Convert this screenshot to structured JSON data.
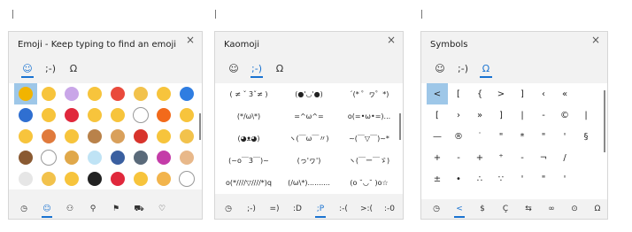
{
  "emoji_panel": {
    "title": "Emoji - Keep typing to find an emoji",
    "close": "×",
    "tabs": [
      {
        "name": "tab-emoji",
        "glyph": "☺"
      },
      {
        "name": "tab-kaomoji",
        "glyph": ";-)"
      },
      {
        "name": "tab-symbols",
        "glyph": "Ω"
      }
    ],
    "cells": [
      {
        "icon": "smiley-face-icon",
        "color": "#f2b400"
      },
      {
        "icon": "grinning-face-icon",
        "color": "#f7c43c"
      },
      {
        "icon": "unicorn-icon",
        "color": "#c9a6e8"
      },
      {
        "icon": "laughing-face-icon",
        "color": "#f7c43c"
      },
      {
        "icon": "alarm-clock-icon",
        "color": "#e94a3c"
      },
      {
        "icon": "thumbs-up-icon",
        "color": "#f2c24c"
      },
      {
        "icon": "smiling-face-icon",
        "color": "#f7c43c"
      },
      {
        "icon": "blue-heart-icon",
        "color": "#2f7de1"
      },
      {
        "icon": "new-button-icon",
        "color": "#2f6fd1"
      },
      {
        "icon": "grinning-face-icon",
        "color": "#f7c43c"
      },
      {
        "icon": "red-heart-icon",
        "color": "#e0283c"
      },
      {
        "icon": "smiling-face-icon",
        "color": "#f7c43c"
      },
      {
        "icon": "tongue-face-icon",
        "color": "#f7c43c"
      },
      {
        "icon": "eyes-icon",
        "color": "#ffffff"
      },
      {
        "icon": "fire-icon",
        "color": "#f26a1b"
      },
      {
        "icon": "crying-face-icon",
        "color": "#f7c43c"
      },
      {
        "icon": "thinking-face-icon",
        "color": "#f7c43c"
      },
      {
        "icon": "planet-icon",
        "color": "#e07a3c"
      },
      {
        "icon": "smirk-face-icon",
        "color": "#f7c43c"
      },
      {
        "icon": "dog-face-icon",
        "color": "#b9824a"
      },
      {
        "icon": "bread-icon",
        "color": "#d9a05b"
      },
      {
        "icon": "chili-pepper-icon",
        "color": "#d8342c"
      },
      {
        "icon": "grinning-face-icon",
        "color": "#f7c43c"
      },
      {
        "icon": "pointing-hand-icon",
        "color": "#f2c24c"
      },
      {
        "icon": "coconut-icon",
        "color": "#8a5a32"
      },
      {
        "icon": "white-heart-icon",
        "color": "#ffffff"
      },
      {
        "icon": "package-icon",
        "color": "#e0a84a"
      },
      {
        "icon": "ice-cube-icon",
        "color": "#bfe3f5"
      },
      {
        "icon": "motorcycle-icon",
        "color": "#3a5fa0"
      },
      {
        "icon": "stethoscope-icon",
        "color": "#5a6a7a"
      },
      {
        "icon": "octopus-icon",
        "color": "#c43ca8"
      },
      {
        "icon": "leg-icon",
        "color": "#e8b88a"
      },
      {
        "icon": "toilet-icon",
        "color": "#e6e6e6"
      },
      {
        "icon": "mage-icon",
        "color": "#f2c24c"
      },
      {
        "icon": "winking-face-icon",
        "color": "#f7c43c"
      },
      {
        "icon": "top-hat-icon",
        "color": "#222222"
      },
      {
        "icon": "siren-icon",
        "color": "#e0283c"
      },
      {
        "icon": "smiling-face-icon",
        "color": "#f7c43c"
      },
      {
        "icon": "cat-face-icon",
        "color": "#f2b44c"
      },
      {
        "icon": "blank-icon",
        "color": "#ffffff"
      }
    ],
    "bottom": [
      {
        "name": "recent-icon",
        "glyph": "◷"
      },
      {
        "name": "smiley-category-icon",
        "glyph": "☺"
      },
      {
        "name": "people-category-icon",
        "glyph": "⚇"
      },
      {
        "name": "balloon-category-icon",
        "glyph": "⚲"
      },
      {
        "name": "flag-category-icon",
        "glyph": "⚑"
      },
      {
        "name": "car-category-icon",
        "glyph": "⛟"
      },
      {
        "name": "heart-category-icon",
        "glyph": "♡"
      }
    ]
  },
  "kaomoji_panel": {
    "title": "Kaomoji",
    "close": "×",
    "tabs": [
      {
        "name": "tab-emoji",
        "glyph": "☺"
      },
      {
        "name": "tab-kaomoji",
        "glyph": ";-)"
      },
      {
        "name": "tab-symbols",
        "glyph": "Ω"
      }
    ],
    "cells": [
      "( ≠ ˇ 3ˇ≠ )",
      "(●'◡'●)",
      "ˊ(* ゜ヮ゜*)",
      "(*/ω\\*)",
      "=^ω^=",
      "o(=•ω•=)...",
      "(◕ᴥ◕)",
      "ヽ(￣ω￣〃)",
      "~(￣▽￣)~*",
      "(~o￣3￣)~",
      "(っ'ヮ')",
      "ヽ(￣ー￣ゞ)",
      "o(*////▽////*)q",
      "(/ω\\*)..........",
      "(o ˘◡˘ )o☆"
    ],
    "bottom": [
      {
        "name": "recent-icon",
        "glyph": "◷"
      },
      {
        "name": "kaomoji-category-1",
        "glyph": ";-)"
      },
      {
        "name": "kaomoji-category-2",
        "glyph": "=)"
      },
      {
        "name": "kaomoji-category-3",
        "glyph": ":D"
      },
      {
        "name": "kaomoji-category-4",
        "glyph": ";P"
      },
      {
        "name": "kaomoji-category-5",
        "glyph": ":-("
      },
      {
        "name": "kaomoji-category-6",
        "glyph": ">:("
      },
      {
        "name": "kaomoji-category-7",
        "glyph": ":-0"
      }
    ]
  },
  "symbols_panel": {
    "title": "Symbols",
    "close": "×",
    "tabs": [
      {
        "name": "tab-emoji",
        "glyph": "☺"
      },
      {
        "name": "tab-kaomoji",
        "glyph": ";-)"
      },
      {
        "name": "tab-symbols",
        "glyph": "Ω"
      }
    ],
    "cells": [
      "<",
      "[",
      "{",
      ">",
      "]",
      "‹",
      "«",
      "",
      "[",
      "›",
      "»",
      "]",
      "|",
      "-",
      "©",
      "|",
      "—",
      "®",
      "˙",
      "\"",
      "*",
      "\"",
      "'",
      "§",
      "+",
      "-",
      "+",
      "⁺",
      "-",
      "¬",
      "/",
      "",
      "±",
      "•",
      "∴",
      "∵",
      "'",
      "\"",
      "'",
      "",
      "",
      "",
      "",
      "",
      "",
      "",
      "",
      ""
    ],
    "bottom": [
      {
        "name": "recent-icon",
        "glyph": "◷"
      },
      {
        "name": "punctuation-category",
        "glyph": "<"
      },
      {
        "name": "currency-category",
        "glyph": "$"
      },
      {
        "name": "latin-category",
        "glyph": "Ç"
      },
      {
        "name": "arrows-category",
        "glyph": "⇆"
      },
      {
        "name": "math-category",
        "glyph": "∞"
      },
      {
        "name": "geometric-category",
        "glyph": "⊙"
      },
      {
        "name": "greek-category",
        "glyph": "Ω"
      }
    ]
  },
  "accent": "#1a73d1",
  "selection": "#9ec7e8"
}
